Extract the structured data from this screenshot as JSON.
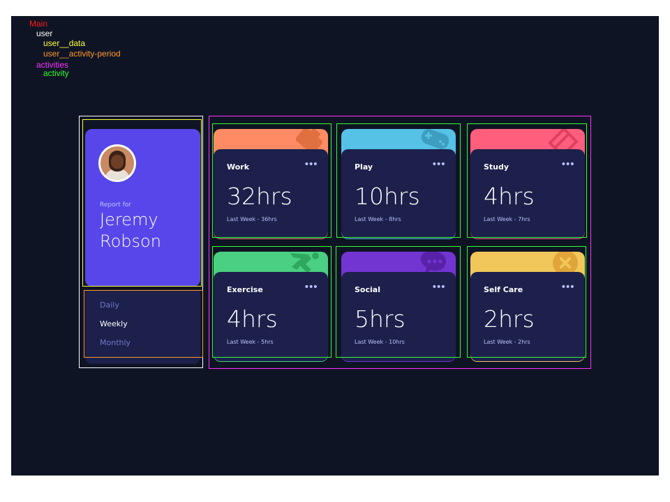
{
  "legend": {
    "main": "Main",
    "user": "user",
    "user_data": "user__data",
    "user_activity_period": "user__activity-period",
    "activities": "activities",
    "activity": "activity"
  },
  "user": {
    "report_for": "Report for",
    "first_name": "Jeremy",
    "last_name": "Robson",
    "periods": [
      "Daily",
      "Weekly",
      "Monthly"
    ],
    "selected_period": "Weekly"
  },
  "activities": [
    {
      "title": "Work",
      "hours": "32hrs",
      "previous": "Last Week - 36hrs",
      "color": "#ff8b64",
      "icon": "work-icon"
    },
    {
      "title": "Play",
      "hours": "10hrs",
      "previous": "Last Week - 8hrs",
      "color": "#55c2e6",
      "icon": "play-icon"
    },
    {
      "title": "Study",
      "hours": "4hrs",
      "previous": "Last Week - 7hrs",
      "color": "#ff5e7d",
      "icon": "study-icon"
    },
    {
      "title": "Exercise",
      "hours": "4hrs",
      "previous": "Last Week - 5hrs",
      "color": "#4bcf82",
      "icon": "exercise-icon"
    },
    {
      "title": "Social",
      "hours": "5hrs",
      "previous": "Last Week - 10hrs",
      "color": "#7335d2",
      "icon": "social-icon"
    },
    {
      "title": "Self Care",
      "hours": "2hrs",
      "previous": "Last Week - 2hrs",
      "color": "#f1c75b",
      "icon": "self-care-icon"
    }
  ],
  "ellipsis": "•••",
  "colors": {
    "background": "#0f1424",
    "user_card": "#5747ea",
    "card": "#1c204b",
    "muted": "#bbc0ff"
  }
}
